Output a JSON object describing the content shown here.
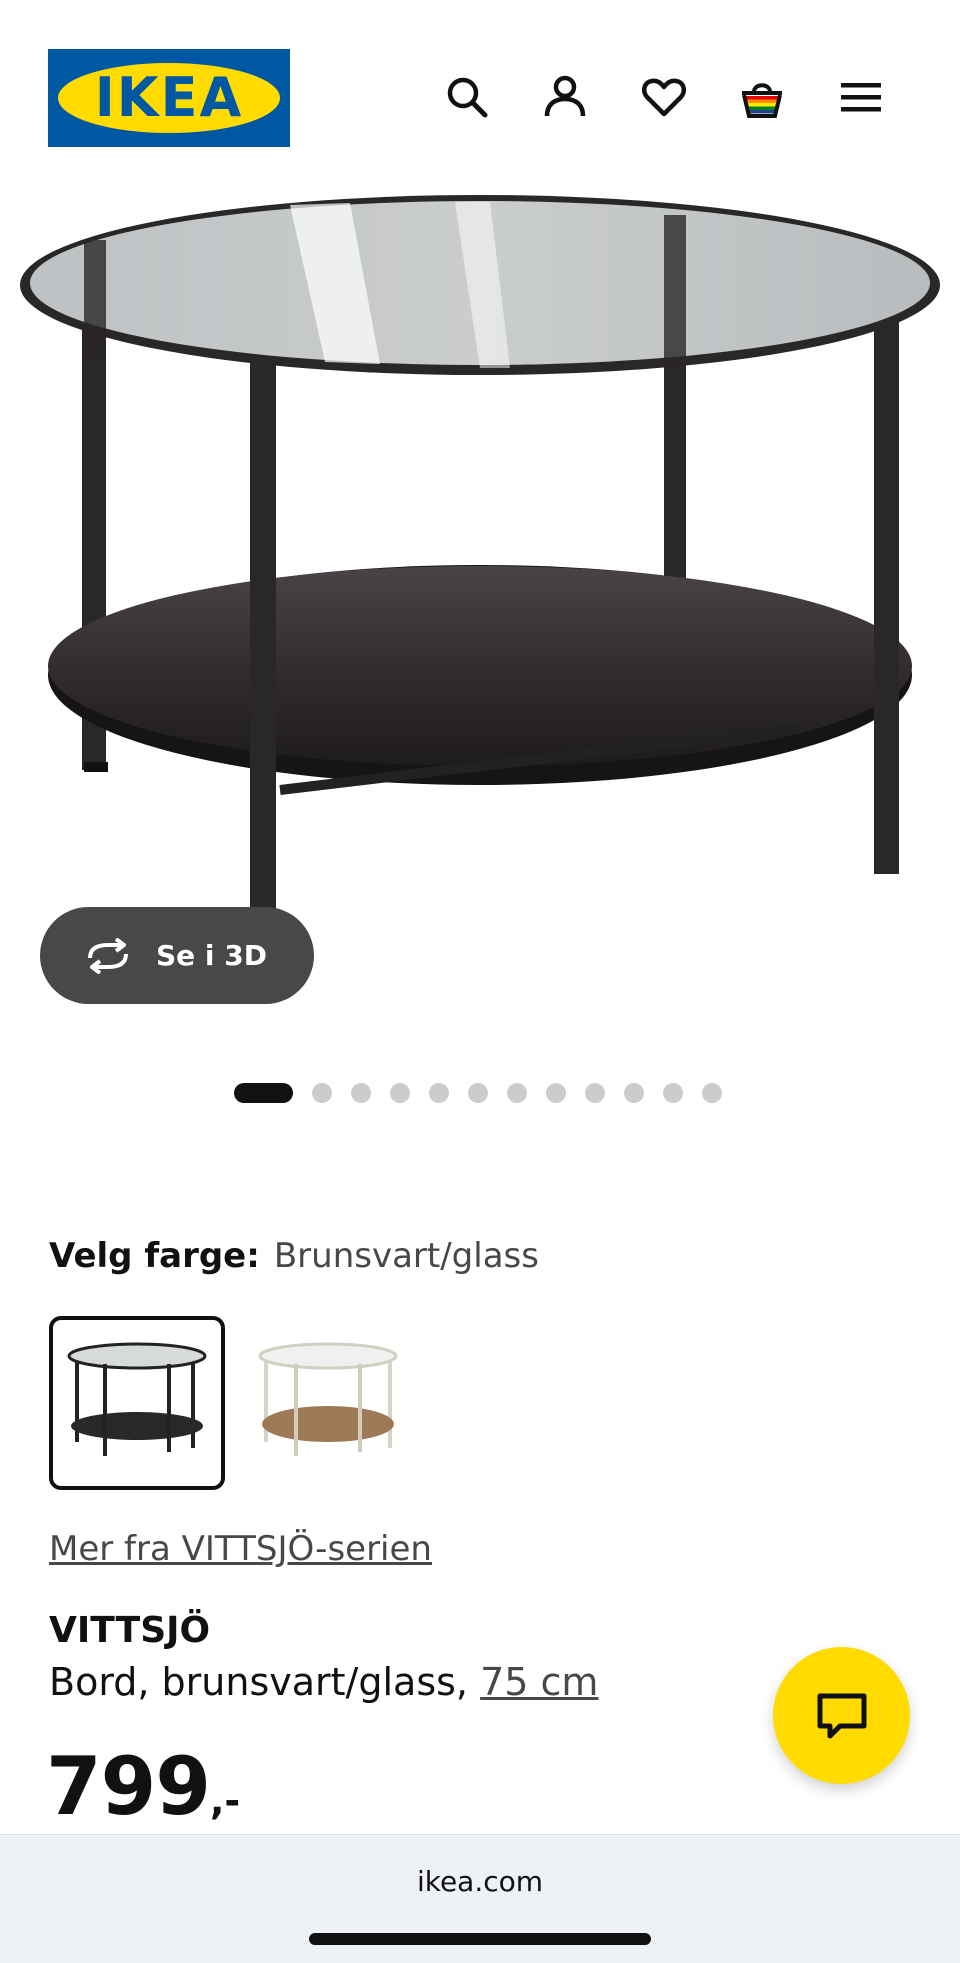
{
  "header": {
    "logo_text": "IKEA",
    "icons": [
      "search-icon",
      "account-icon",
      "heart-icon",
      "basket-icon",
      "menu-icon"
    ]
  },
  "gallery": {
    "view3d_label": "Se i 3D",
    "image_count": 12,
    "active_index": 0
  },
  "color": {
    "label": "Velg farge:",
    "selected": "Brunsvart/glass",
    "options": [
      "brunsvart-glass",
      "hvit-eikemønstret"
    ]
  },
  "series_link": "Mer fra VITTSJÖ-serien",
  "product": {
    "name": "VITTSJÖ",
    "description": "Bord, brunsvart/glass,",
    "size": "75 cm"
  },
  "price": {
    "amount": "799",
    "suffix": ",-"
  },
  "browser": {
    "url": "ikea.com"
  },
  "colors": {
    "ikea_blue": "#0058a3",
    "ikea_yellow": "#ffdb00",
    "dark_pill": "#484848"
  }
}
